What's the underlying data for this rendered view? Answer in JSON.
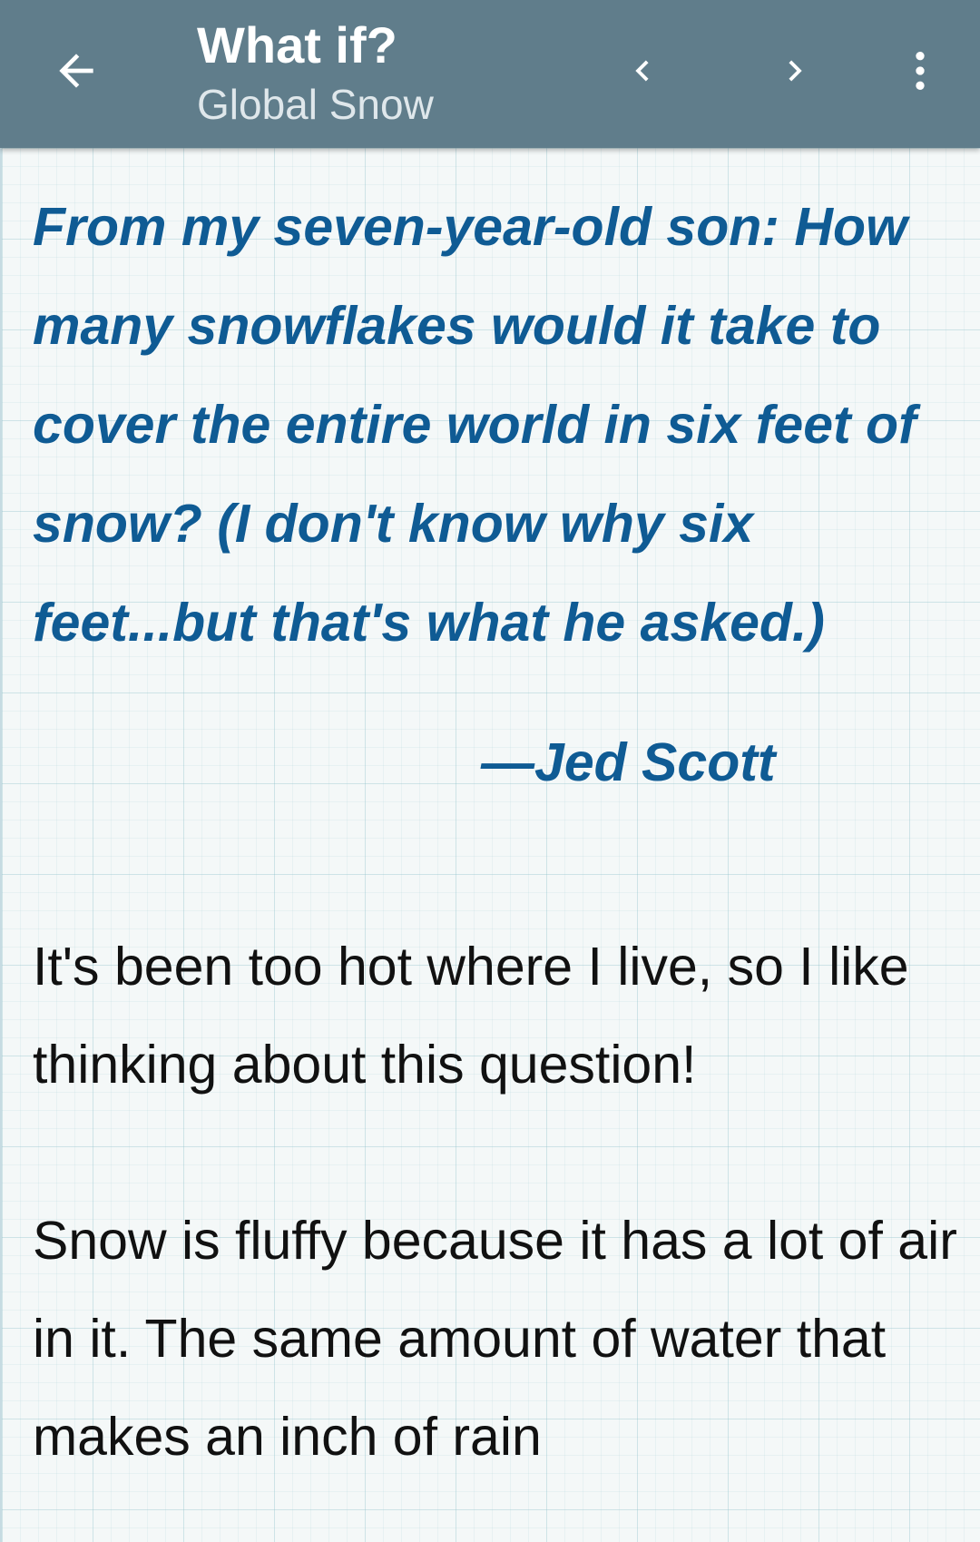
{
  "appbar": {
    "title": "What if?",
    "subtitle": "Global Snow",
    "icons": {
      "back": "arrow-left-icon",
      "previous": "chevron-left-icon",
      "next": "chevron-right-icon",
      "menu": "more-vertical-icon"
    },
    "background_color": "#607d8b"
  },
  "article": {
    "question": "From my seven-year-old son: How many snowflakes would it take to cover the entire world in six feet of snow? (I don't know why six feet...but that's what he asked.)",
    "attribution": "—Jed Scott",
    "paragraphs": [
      "It's been too hot where I live, so I like thinking about this question!",
      "Snow is fluffy because it has a lot of air in it. The same amount of water that makes an inch of rain"
    ],
    "question_color": "#0f5b94",
    "text_color": "#111111"
  }
}
